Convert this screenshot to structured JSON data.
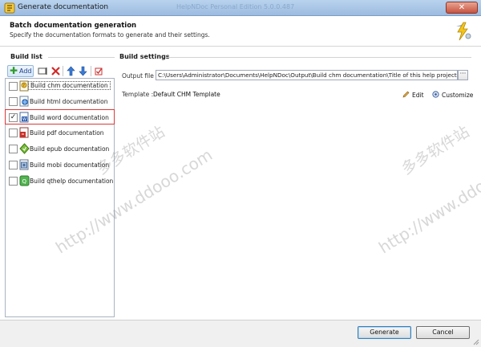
{
  "window": {
    "title": "Generate documentation",
    "background_title": "HelpNDoc Personal Edition 5.0.0.487",
    "close_glyph": "✕"
  },
  "header": {
    "title": "Batch documentation generation",
    "subtitle": "Specify the documentation formats to generate and their settings."
  },
  "build_list": {
    "label": "Build list",
    "add_label": "Add",
    "items": [
      {
        "label": "Build chm documentation",
        "checked": false,
        "icon": "chm-help-icon",
        "color": "#c9a23a"
      },
      {
        "label": "Build html documentation",
        "checked": false,
        "icon": "html-doc-icon",
        "color": "#3d7cc9"
      },
      {
        "label": "Build word documentation",
        "checked": true,
        "icon": "word-doc-icon",
        "color": "#2f5fb3"
      },
      {
        "label": "Build pdf documentation",
        "checked": false,
        "icon": "pdf-doc-icon",
        "color": "#c8312a"
      },
      {
        "label": "Build epub documentation",
        "checked": false,
        "icon": "epub-doc-icon",
        "color": "#6aa52f"
      },
      {
        "label": "Build mobi documentation",
        "checked": false,
        "icon": "mobi-doc-icon",
        "color": "#4a6fa0"
      },
      {
        "label": "Build qthelp documentation",
        "checked": false,
        "icon": "qthelp-doc-icon",
        "color": "#45a04a"
      }
    ]
  },
  "build_settings": {
    "label": "Build settings",
    "output_label": "Output file :",
    "output_value": "C:\\Users\\Administrator\\Documents\\HelpNDoc\\Output\\Build chm documentation\\Title of this help project.chm",
    "browse_label": "···",
    "template_label": "Template :",
    "template_value": "Default CHM Template",
    "edit_label": "Edit",
    "customize_label": "Customize"
  },
  "footer": {
    "generate_label": "Generate",
    "cancel_label": "Cancel"
  },
  "watermark": {
    "cn_text": "多多软件站",
    "url_text": "http://www.ddooo.com"
  },
  "colors": {
    "titlebar": "#b0cbe9",
    "accent": "#2e6bc5",
    "selection_border": "#d93a3a",
    "close": "#c75340"
  }
}
